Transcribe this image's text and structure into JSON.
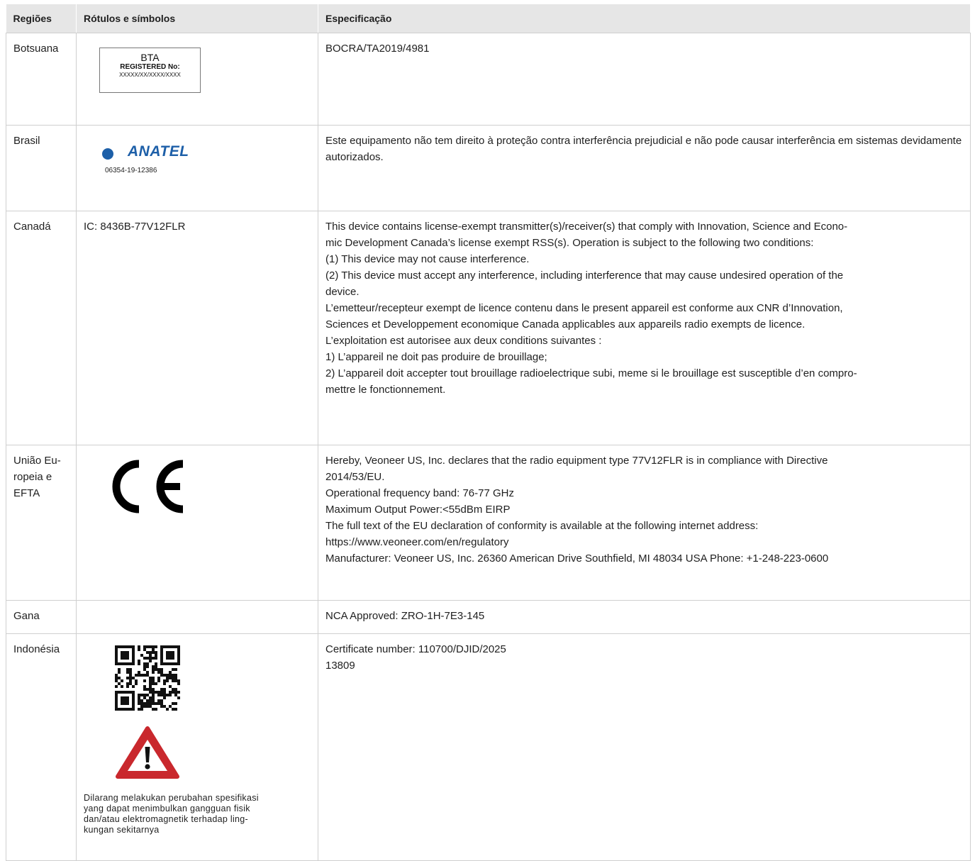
{
  "headers": {
    "regions": "Regiões",
    "labels": "Rótulos e símbolos",
    "spec": "Especificação"
  },
  "rows": {
    "botswana": {
      "region": "Botsuana",
      "label": {
        "title": "BTA",
        "registered": "REGISTERED No:",
        "number": "XXXXX/XX/XXXX/XXXX"
      },
      "spec": "BOCRA/TA2019/4981"
    },
    "brazil": {
      "region": "Brasil",
      "label": {
        "logo_text": "ANATEL",
        "number": "06354-19-12386",
        "logo_colors": {
          "yellow": "#f2c300",
          "blue": "#1d5fa8"
        }
      },
      "spec": "Este equipamento não tem direito à proteção contra interferência prejudicial e não pode causar interferência em sistemas devidamente autorizados."
    },
    "canada": {
      "region": "Canadá",
      "label": "IC: 8436B-77V12FLR",
      "spec": [
        "This device contains license-exempt transmitter(s)/receiver(s) that comply with Innovation, Science and Econo-",
        "mic Development Canada’s license exempt RSS(s). Operation is subject to the following two conditions:",
        "(1) This device may not cause interference.",
        "(2) This device must accept any interference, including interference that may cause undesired operation of the",
        "device.",
        "L’emetteur/recepteur exempt de licence contenu dans le present appareil est conforme aux CNR d’Innovation,",
        "Sciences et Developpement economique Canada applicables aux appareils radio exempts de licence.",
        "L’exploitation est autorisee aux deux conditions suivantes :",
        "1) L’appareil ne doit pas produire de brouillage;",
        "2) L’appareil doit accepter tout brouillage radioelectrique subi, meme si le brouillage est susceptible d’en compro-",
        "mettre le fonctionnement."
      ]
    },
    "eu": {
      "region_lines": [
        "União Eu-",
        "ropeia e",
        "EFTA"
      ],
      "label_icon": "ce-mark-icon",
      "spec": [
        "Hereby, Veoneer US, Inc. declares that the radio equipment type 77V12FLR is in compliance with Directive",
        "2014/53/EU.",
        "Operational frequency band: 76-77 GHz",
        "Maximum Output Power:<55dBm EIRP",
        "The full text of the EU declaration of conformity is available at the following internet address:",
        "https://www.veoneer.com/en/regulatory",
        "Manufacturer: Veoneer US, Inc. 26360 American Drive Southfield, MI 48034 USA Phone: +1-248-223-0600"
      ]
    },
    "ghana": {
      "region": "Gana",
      "spec": "NCA Approved: ZRO-1H-7E3-145"
    },
    "indonesia": {
      "region": "Indonésia",
      "label_icons": [
        "qr-code-icon",
        "warning-triangle-icon"
      ],
      "warning_color": "#c9282d",
      "label_text": [
        "Dilarang melakukan perubahan spesifikasi",
        "yang dapat menimbulkan gangguan fisik",
        "dan/atau elektromagnetik terhadap ling-",
        "kungan sekitarnya"
      ],
      "spec": [
        "Certificate number: 110700/DJID/2025",
        "13809"
      ]
    }
  }
}
